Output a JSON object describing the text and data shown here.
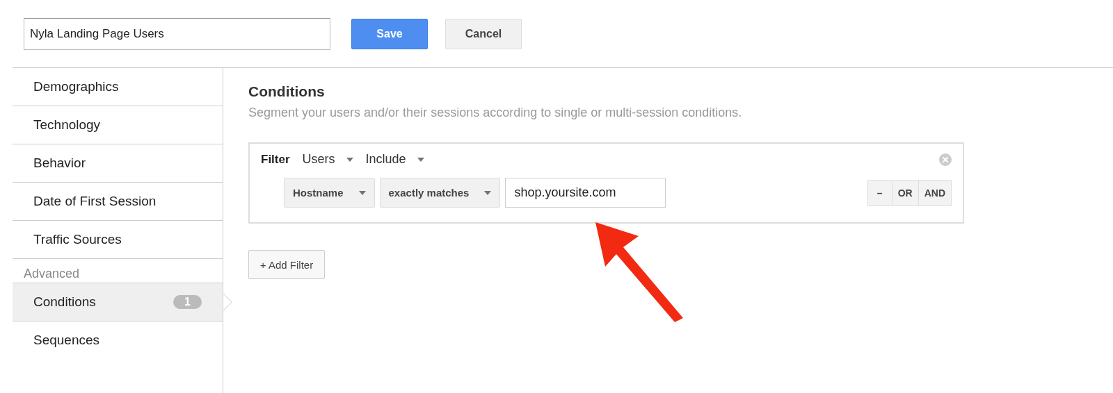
{
  "segment_name": {
    "value": "Nyla Landing Page Users"
  },
  "buttons": [
    {
      "label": "Save",
      "kind": "primary"
    },
    {
      "label": "Cancel",
      "kind": "secondary"
    }
  ],
  "sidebar": {
    "items": [
      {
        "label": "Demographics",
        "selected": false
      },
      {
        "label": "Technology",
        "selected": false
      },
      {
        "label": "Behavior",
        "selected": false
      },
      {
        "label": "Date of First Session",
        "selected": false
      },
      {
        "label": "Traffic Sources",
        "selected": false
      }
    ],
    "section": "Advanced",
    "advanced_items": [
      {
        "label": "Conditions",
        "selected": true,
        "badge": "1"
      },
      {
        "label": "Sequences",
        "selected": false
      }
    ]
  },
  "main": {
    "title": "Conditions",
    "subtitle": "Segment your users and/or their sessions according to single or multi-session conditions.",
    "filter": {
      "label": "Filter",
      "scope": "Users",
      "mode": "Include",
      "dimension": "Hostname",
      "match": "exactly matches",
      "value": "shop.yoursite.com",
      "actions": [
        "–",
        "OR",
        "AND"
      ]
    },
    "add_filter": "+ Add Filter"
  }
}
